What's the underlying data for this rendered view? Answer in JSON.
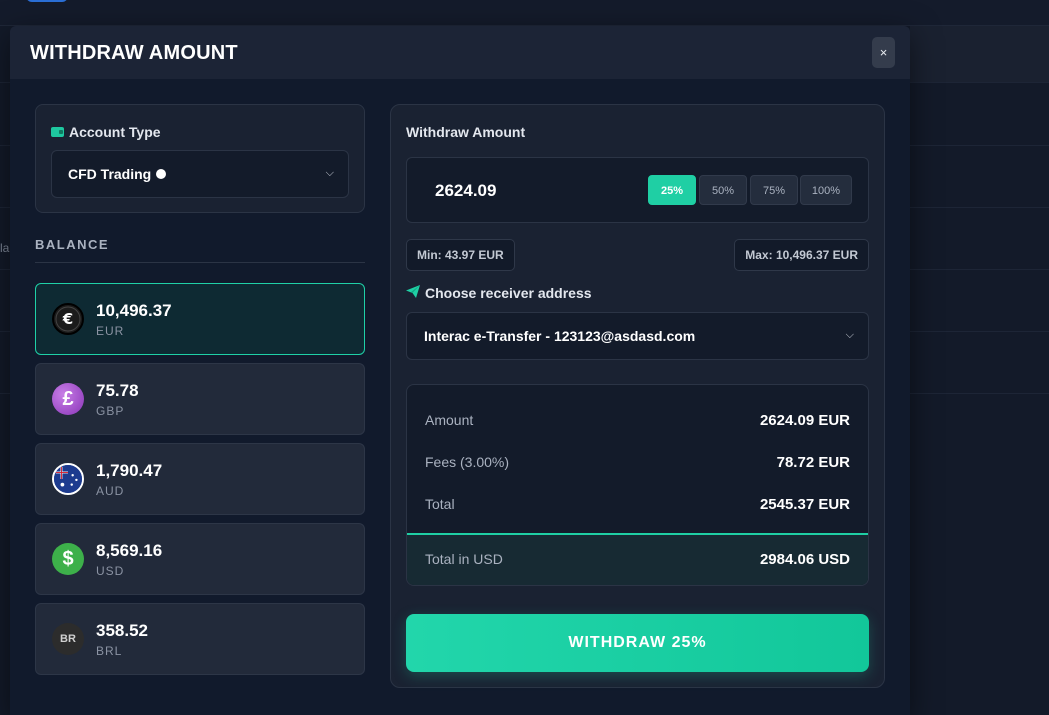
{
  "background": {
    "edge_text": "la"
  },
  "modal": {
    "title": "WITHDRAW AMOUNT",
    "close_label": "×"
  },
  "account": {
    "label": "Account Type",
    "selected": "CFD Trading",
    "chevron": "⌄",
    "icon": "wallet-icon"
  },
  "balance": {
    "title": "BALANCE",
    "items": [
      {
        "amount": "10,496.37",
        "currency": "EUR",
        "symbol": "€",
        "icon": "euro-icon",
        "color": "#1b1b1b",
        "active": true
      },
      {
        "amount": "75.78",
        "currency": "GBP",
        "symbol": "£",
        "icon": "pound-icon",
        "color": "#9b4fc8",
        "active": false
      },
      {
        "amount": "1,790.47",
        "currency": "AUD",
        "symbol": "",
        "icon": "australia-flag-icon",
        "color": "#1c3a8a",
        "active": false
      },
      {
        "amount": "8,569.16",
        "currency": "USD",
        "symbol": "$",
        "icon": "dollar-icon",
        "color": "#3db04a",
        "active": false
      },
      {
        "amount": "358.52",
        "currency": "BRL",
        "symbol": "BR",
        "icon": "brl-icon",
        "color": "#2b2b2b",
        "active": false
      }
    ]
  },
  "withdraw": {
    "label": "Withdraw Amount",
    "value": "2624.09",
    "percent_options": [
      "25%",
      "50%",
      "75%",
      "100%"
    ],
    "selected_percent": "25%",
    "min_label": "Min: 43.97 EUR",
    "max_label": "Max: 10,496.37 EUR"
  },
  "receiver": {
    "label": "Choose receiver address",
    "icon": "paper-plane-icon",
    "selected": "Interac e-Transfer - 123123@asdasd.com",
    "chevron": "⌄"
  },
  "summary": {
    "rows": [
      {
        "label": "Amount",
        "value": "2624.09 EUR"
      },
      {
        "label": "Fees (3.00%)",
        "value": "78.72 EUR"
      },
      {
        "label": "Total",
        "value": "2545.37 EUR"
      }
    ],
    "total_usd_label": "Total in USD",
    "total_usd_value": "2984.06 USD"
  },
  "button": {
    "label": "WITHDRAW 25%"
  },
  "colors": {
    "accent": "#1fcfa4",
    "modal_bg": "#111a2c",
    "card_bg": "#1a2232"
  }
}
